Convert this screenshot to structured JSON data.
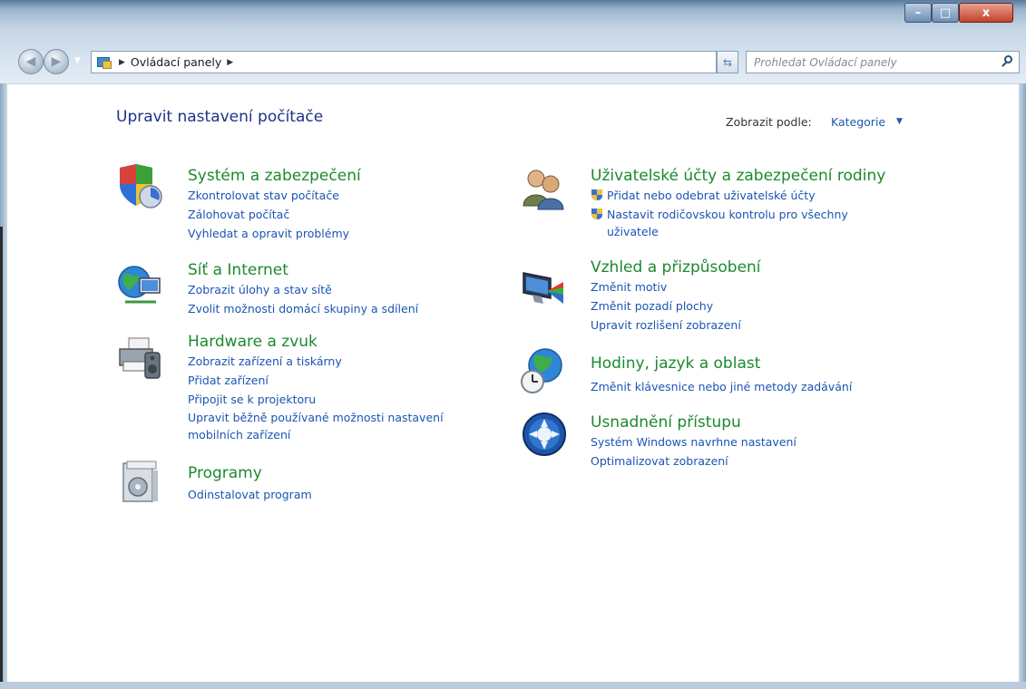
{
  "window": {
    "caption_buttons": {
      "minimize": "–",
      "maximize": "□",
      "close": "x"
    }
  },
  "navbar": {
    "breadcrumb": "Ovládací panely",
    "search_placeholder": "Prohledat Ovládací panely"
  },
  "header": {
    "title": "Upravit nastavení počítače",
    "view_by_label": "Zobrazit podle:",
    "view_by_value": "Kategorie"
  },
  "categories": {
    "system": {
      "title": "Systém a zabezpečení",
      "links": [
        "Zkontrolovat stav počítače",
        "Zálohovat počítač",
        "Vyhledat a opravit problémy"
      ]
    },
    "network": {
      "title": "Síť a Internet",
      "links": [
        "Zobrazit úlohy a stav sítě",
        "Zvolit možnosti domácí skupiny a sdílení"
      ]
    },
    "hardware": {
      "title": "Hardware a zvuk",
      "links": [
        "Zobrazit zařízení a tiskárny",
        "Přidat zařízení",
        "Připojit se k projektoru",
        "Upravit běžně používané možnosti nastavení mobilních zařízení"
      ],
      "link4_line1": "Upravit běžně používané možnosti nastavení",
      "link4_line2": "mobilních zařízení"
    },
    "programs": {
      "title": "Programy",
      "links": [
        "Odinstalovat program"
      ]
    },
    "users": {
      "title": "Uživatelské účty a zabezpečení rodiny",
      "links": [
        "Přidat nebo odebrat uživatelské účty",
        "Nastavit rodičovskou kontrolu pro všechny uživatele"
      ],
      "link2_line1": "Nastavit rodičovskou kontrolu pro všechny",
      "link2_line2": "uživatele"
    },
    "appearance": {
      "title": "Vzhled a přizpůsobení",
      "links": [
        "Změnit motiv",
        "Změnit pozadí plochy",
        "Upravit rozlišení zobrazení"
      ]
    },
    "clock": {
      "title": "Hodiny, jazyk a oblast",
      "links": [
        "Změnit klávesnice nebo jiné metody zadávání"
      ]
    },
    "ease": {
      "title": "Usnadnění přístupu",
      "links": [
        "Systém Windows navrhne nastavení",
        "Optimalizovat zobrazení"
      ]
    }
  }
}
